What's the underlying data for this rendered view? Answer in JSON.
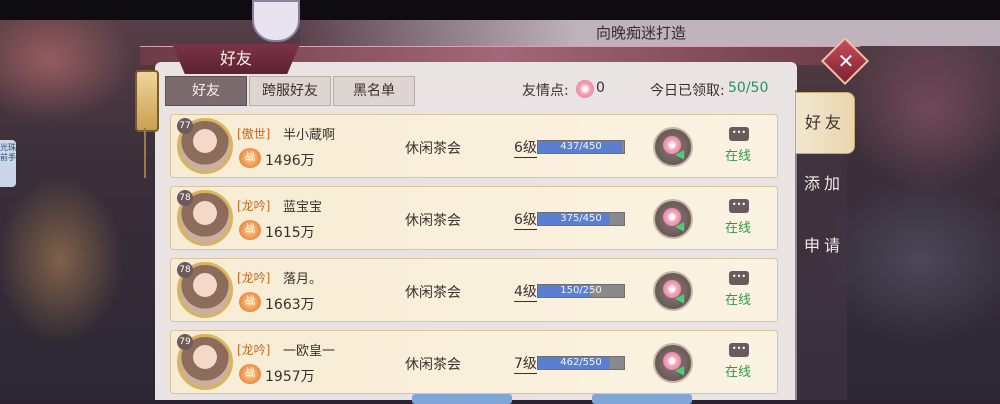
{
  "header": {
    "title": "向晚痴迷打造",
    "panel_title": "好友"
  },
  "sidebar_left": {
    "tag": "光珠前手"
  },
  "tabs": [
    {
      "label": "好友",
      "active": true
    },
    {
      "label": "跨服好友",
      "active": false
    },
    {
      "label": "黑名单",
      "active": false
    }
  ],
  "stats": {
    "friend_points_label": "友情点:",
    "friend_points_value": "0",
    "claimed_label": "今日已领取:",
    "claimed_value": "50/50"
  },
  "side_nav": [
    {
      "label": "好友",
      "active": true
    },
    {
      "label": "添加",
      "active": false
    },
    {
      "label": "申请",
      "active": false
    }
  ],
  "friends": [
    {
      "level": "77",
      "guild": "[傲世]",
      "name": "半小蔵啊",
      "power": "1496万",
      "area": "休闲茶会",
      "intimacy_level": "6级",
      "intimacy": "437/450",
      "intimacy_fraction": 0.971,
      "status": "在线"
    },
    {
      "level": "78",
      "guild": "[龙吟]",
      "name": "蓝宝宝",
      "power": "1615万",
      "area": "休闲茶会",
      "intimacy_level": "6级",
      "intimacy": "375/450",
      "intimacy_fraction": 0.833,
      "status": "在线"
    },
    {
      "level": "78",
      "guild": "[龙吟]",
      "name": "落月。",
      "power": "1663万",
      "area": "休闲茶会",
      "intimacy_level": "4级",
      "intimacy": "150/250",
      "intimacy_fraction": 0.6,
      "status": "在线"
    },
    {
      "level": "79",
      "guild": "[龙吟]",
      "name": "一欧皇一",
      "power": "1957万",
      "area": "休闲茶会",
      "intimacy_level": "7级",
      "intimacy": "462/550",
      "intimacy_fraction": 0.84,
      "status": "在线"
    }
  ],
  "colors": {
    "accent": "#7b6a6e",
    "online": "#2f9a4a",
    "guild": "#c9691c",
    "bar": "#5a7fd0"
  }
}
